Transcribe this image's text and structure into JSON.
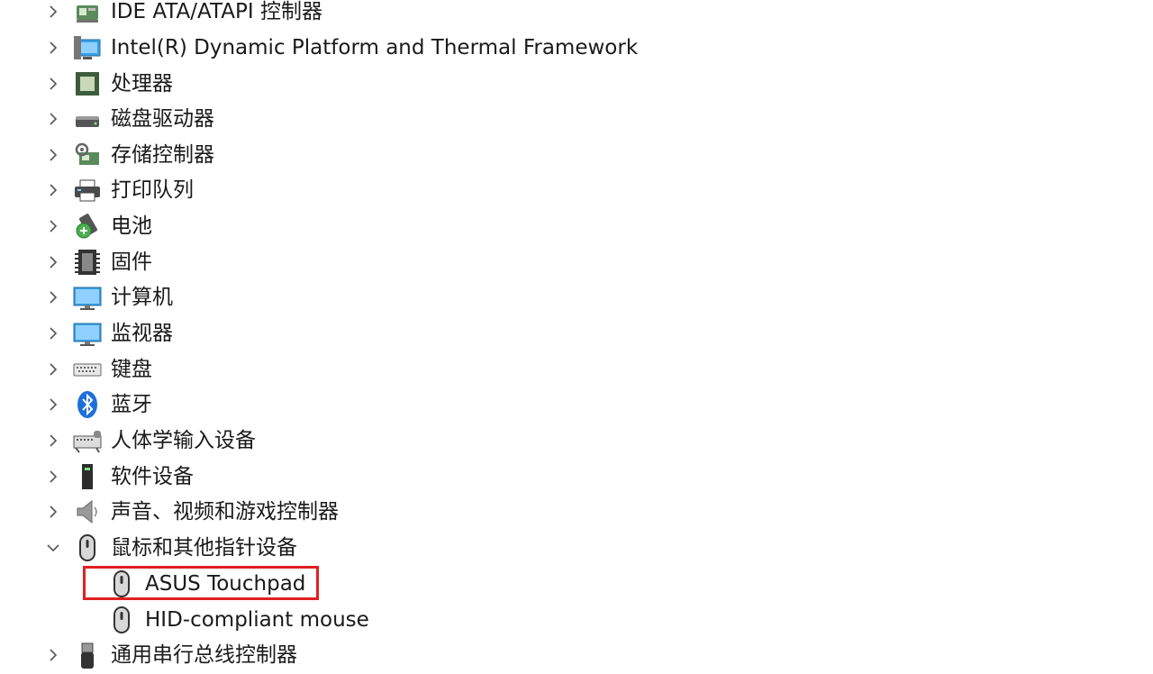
{
  "tree": {
    "items": [
      {
        "label": "IDE ATA/ATAPI 控制器",
        "icon": "ide-controller-icon",
        "expanded": false
      },
      {
        "label": "Intel(R) Dynamic Platform and Thermal Framework",
        "icon": "intel-thermal-icon",
        "expanded": false
      },
      {
        "label": "处理器",
        "icon": "processor-icon",
        "expanded": false
      },
      {
        "label": "磁盘驱动器",
        "icon": "disk-drive-icon",
        "expanded": false
      },
      {
        "label": "存储控制器",
        "icon": "storage-controller-icon",
        "expanded": false
      },
      {
        "label": "打印队列",
        "icon": "printer-icon",
        "expanded": false
      },
      {
        "label": "电池",
        "icon": "battery-icon",
        "expanded": false
      },
      {
        "label": "固件",
        "icon": "firmware-icon",
        "expanded": false
      },
      {
        "label": "计算机",
        "icon": "computer-icon",
        "expanded": false
      },
      {
        "label": "监视器",
        "icon": "monitor-icon",
        "expanded": false
      },
      {
        "label": "键盘",
        "icon": "keyboard-icon",
        "expanded": false
      },
      {
        "label": "蓝牙",
        "icon": "bluetooth-icon",
        "expanded": false
      },
      {
        "label": "人体学输入设备",
        "icon": "hid-icon",
        "expanded": false
      },
      {
        "label": "软件设备",
        "icon": "software-device-icon",
        "expanded": false
      },
      {
        "label": "声音、视频和游戏控制器",
        "icon": "speaker-icon",
        "expanded": false
      },
      {
        "label": "鼠标和其他指针设备",
        "icon": "mouse-icon",
        "expanded": true
      },
      {
        "label": "ASUS Touchpad",
        "icon": "mouse-icon",
        "child": true,
        "highlighted": true
      },
      {
        "label": "HID-compliant mouse",
        "icon": "mouse-icon",
        "child": true
      },
      {
        "label": "通用串行总线控制器",
        "icon": "usb-icon",
        "expanded": false
      }
    ]
  },
  "colors": {
    "highlight_border": "#e02020",
    "monitor_blue": "#3aa0e6",
    "bluetooth_blue": "#1e6fd9"
  }
}
